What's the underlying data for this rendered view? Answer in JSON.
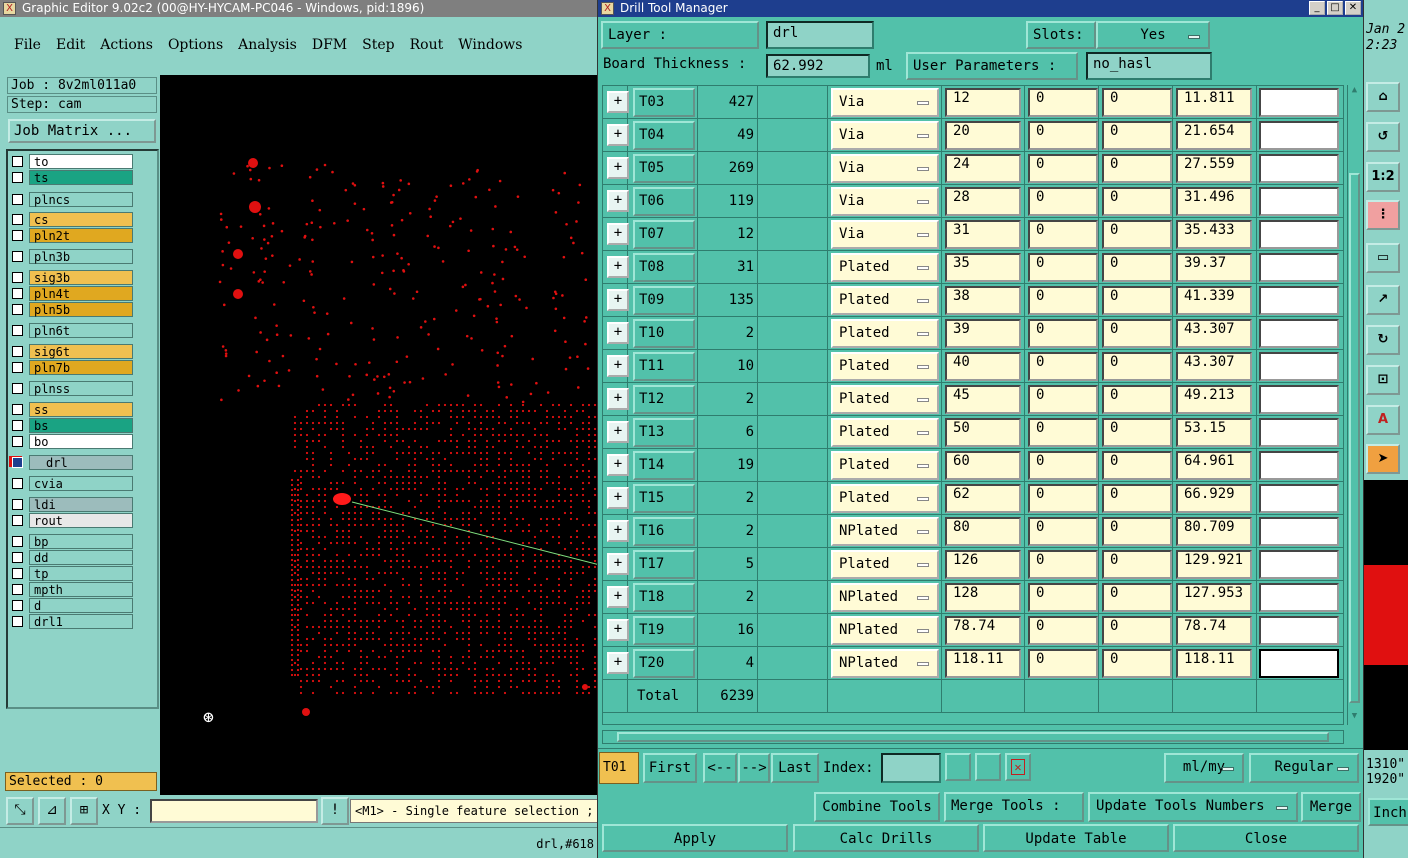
{
  "editor": {
    "title": "Graphic Editor 9.02c2 (00@HY-HYCAM-PC046 - Windows, pid:1896)",
    "menu": [
      "File",
      "Edit",
      "Actions",
      "Options",
      "Analysis",
      "DFM",
      "Step",
      "Rout",
      "Windows"
    ],
    "job": "Job : 8v2ml011a0",
    "step": "Step: cam",
    "job_matrix": "Job Matrix ...",
    "layers": [
      {
        "name": "to",
        "color": "#ffffff"
      },
      {
        "name": "ts",
        "color": "#1aa383"
      },
      {
        "name": "plncs",
        "color": "#8fd3c7"
      },
      {
        "name": "cs",
        "color": "#f0c050"
      },
      {
        "name": "pln2t",
        "color": "#e0a820"
      },
      {
        "name": "pln3b",
        "color": "#8fd3c7"
      },
      {
        "name": "sig3b",
        "color": "#f0c050"
      },
      {
        "name": "pln4t",
        "color": "#e0a820"
      },
      {
        "name": "pln5b",
        "color": "#e0a820"
      },
      {
        "name": "pln6t",
        "color": "#8fd3c7"
      },
      {
        "name": "sig6t",
        "color": "#f0c050"
      },
      {
        "name": "pln7b",
        "color": "#e0a820"
      },
      {
        "name": "plnss",
        "color": "#8fd3c7"
      },
      {
        "name": "ss",
        "color": "#f0c050"
      },
      {
        "name": "bs",
        "color": "#1aa383"
      },
      {
        "name": "bo",
        "color": "#ffffff"
      },
      {
        "name": "drl",
        "color": "#9cbcbc"
      },
      {
        "name": "cvia",
        "color": "#8fd3c7"
      },
      {
        "name": "ldi",
        "color": "#9cbcbc"
      },
      {
        "name": "rout",
        "color": "#e8e8e8"
      },
      {
        "name": "bp",
        "color": "#8fd3c7"
      },
      {
        "name": "dd",
        "color": "#8fd3c7"
      },
      {
        "name": "tp",
        "color": "#8fd3c7"
      },
      {
        "name": "mpth",
        "color": "#8fd3c7"
      },
      {
        "name": "d",
        "color": "#8fd3c7"
      },
      {
        "name": "drl1",
        "color": "#8fd3c7"
      }
    ],
    "selected": "Selected : 0",
    "xy_label": "X Y :",
    "message": "<M1> - Single feature selection ;",
    "status": "drl,#618"
  },
  "dtm": {
    "title": "Drill Tool Manager",
    "layer_label": "Layer        :",
    "layer_value": "drl",
    "slots_label": "Slots:",
    "slots_value": "Yes",
    "thickness_label": "Board Thickness :",
    "thickness_value": "62.992",
    "thickness_unit": "ml",
    "user_params_label": "User Parameters :",
    "user_params_value": "no_hasl",
    "rows": [
      {
        "tool": "T03",
        "count": "427",
        "type": "Via",
        "size": "12",
        "p1": "0",
        "p2": "0",
        "drill": "11.811"
      },
      {
        "tool": "T04",
        "count": "49",
        "type": "Via",
        "size": "20",
        "p1": "0",
        "p2": "0",
        "drill": "21.654"
      },
      {
        "tool": "T05",
        "count": "269",
        "type": "Via",
        "size": "24",
        "p1": "0",
        "p2": "0",
        "drill": "27.559"
      },
      {
        "tool": "T06",
        "count": "119",
        "type": "Via",
        "size": "28",
        "p1": "0",
        "p2": "0",
        "drill": "31.496"
      },
      {
        "tool": "T07",
        "count": "12",
        "type": "Via",
        "size": "31",
        "p1": "0",
        "p2": "0",
        "drill": "35.433"
      },
      {
        "tool": "T08",
        "count": "31",
        "type": "Plated",
        "size": "35",
        "p1": "0",
        "p2": "0",
        "drill": "39.37"
      },
      {
        "tool": "T09",
        "count": "135",
        "type": "Plated",
        "size": "38",
        "p1": "0",
        "p2": "0",
        "drill": "41.339"
      },
      {
        "tool": "T10",
        "count": "2",
        "type": "Plated",
        "size": "39",
        "p1": "0",
        "p2": "0",
        "drill": "43.307"
      },
      {
        "tool": "T11",
        "count": "10",
        "type": "Plated",
        "size": "40",
        "p1": "0",
        "p2": "0",
        "drill": "43.307"
      },
      {
        "tool": "T12",
        "count": "2",
        "type": "Plated",
        "size": "45",
        "p1": "0",
        "p2": "0",
        "drill": "49.213"
      },
      {
        "tool": "T13",
        "count": "6",
        "type": "Plated",
        "size": "50",
        "p1": "0",
        "p2": "0",
        "drill": "53.15"
      },
      {
        "tool": "T14",
        "count": "19",
        "type": "Plated",
        "size": "60",
        "p1": "0",
        "p2": "0",
        "drill": "64.961"
      },
      {
        "tool": "T15",
        "count": "2",
        "type": "Plated",
        "size": "62",
        "p1": "0",
        "p2": "0",
        "drill": "66.929"
      },
      {
        "tool": "T16",
        "count": "2",
        "type": "NPlated",
        "size": "80",
        "p1": "0",
        "p2": "0",
        "drill": "80.709"
      },
      {
        "tool": "T17",
        "count": "5",
        "type": "Plated",
        "size": "126",
        "p1": "0",
        "p2": "0",
        "drill": "129.921"
      },
      {
        "tool": "T18",
        "count": "2",
        "type": "NPlated",
        "size": "128",
        "p1": "0",
        "p2": "0",
        "drill": "127.953"
      },
      {
        "tool": "T19",
        "count": "16",
        "type": "NPlated",
        "size": "78.74",
        "p1": "0",
        "p2": "0",
        "drill": "78.74"
      },
      {
        "tool": "T20",
        "count": "4",
        "type": "NPlated",
        "size": "118.11",
        "p1": "0",
        "p2": "0",
        "drill": "118.11"
      }
    ],
    "total_label": "Total",
    "total_value": "6239",
    "current_tool": "T01",
    "nav": {
      "first": "First",
      "prev": "<--",
      "next": "-->",
      "last": "Last",
      "index": "Index:"
    },
    "units": "ml/my",
    "mode": "Regular",
    "combine": "Combine Tools",
    "merge_label": "Merge Tools :",
    "merge_option": "Update Tools Numbers",
    "merge": "Merge",
    "apply": "Apply",
    "calc": "Calc Drills",
    "update": "Update Table",
    "close": "Close"
  },
  "rightstrip": {
    "date": "Jan 2",
    "time": "2:23",
    "coord1": "1310\"",
    "coord2": "1920\"",
    "units": "Inch"
  }
}
